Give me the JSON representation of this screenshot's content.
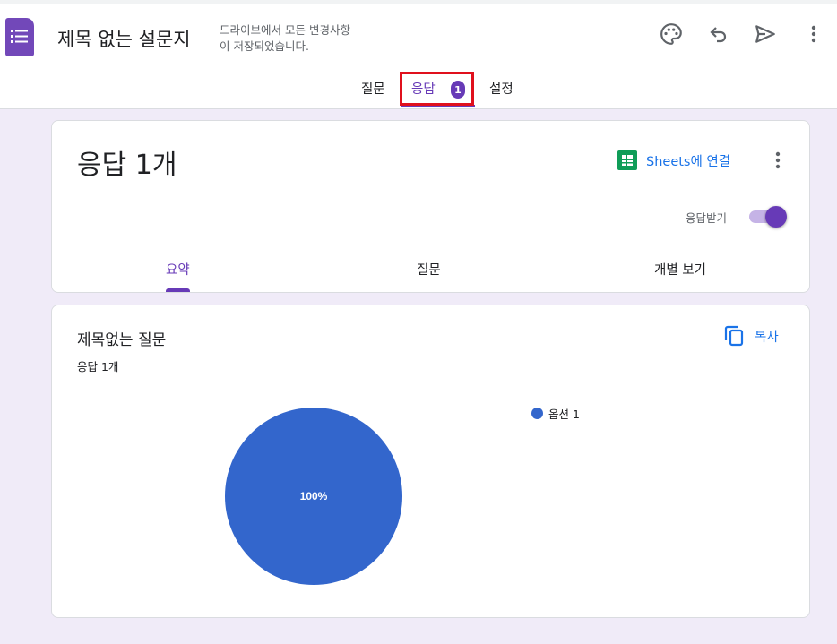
{
  "header": {
    "title": "제목 없는 설문지",
    "save_status_line1": "드라이브에서 모든 변경사항",
    "save_status_line2": "이 저장되었습니다."
  },
  "nav": {
    "tabs": [
      {
        "label": "질문"
      },
      {
        "label": "응답",
        "badge": "1",
        "active": true
      },
      {
        "label": "설정"
      }
    ]
  },
  "summary_card": {
    "title": "응답 1개",
    "sheets_link": "Sheets에 연결",
    "accepting_label": "응답받기",
    "accepting_on": true,
    "subtabs": [
      {
        "label": "요약",
        "active": true
      },
      {
        "label": "질문"
      },
      {
        "label": "개별 보기"
      }
    ]
  },
  "question_card": {
    "title": "제목없는 질문",
    "response_count": "응답 1개",
    "copy_label": "복사",
    "chart_data": {
      "type": "pie",
      "categories": [
        "옵션 1"
      ],
      "values": [
        100
      ],
      "data_labels": [
        "100%"
      ],
      "colors": [
        "#3366cc"
      ],
      "legend_position": "right"
    }
  },
  "colors": {
    "accent": "#673ab7",
    "link": "#1a73e8",
    "sheets_green": "#0f9d58",
    "background": "#f0ebf8",
    "highlight": "#e0101d"
  },
  "icons": {
    "app": "forms-list-icon",
    "palette": "palette-icon",
    "undo": "undo-icon",
    "send": "send-icon",
    "more": "more-vert-icon",
    "sheets": "sheets-icon",
    "copy": "copy-icon"
  }
}
